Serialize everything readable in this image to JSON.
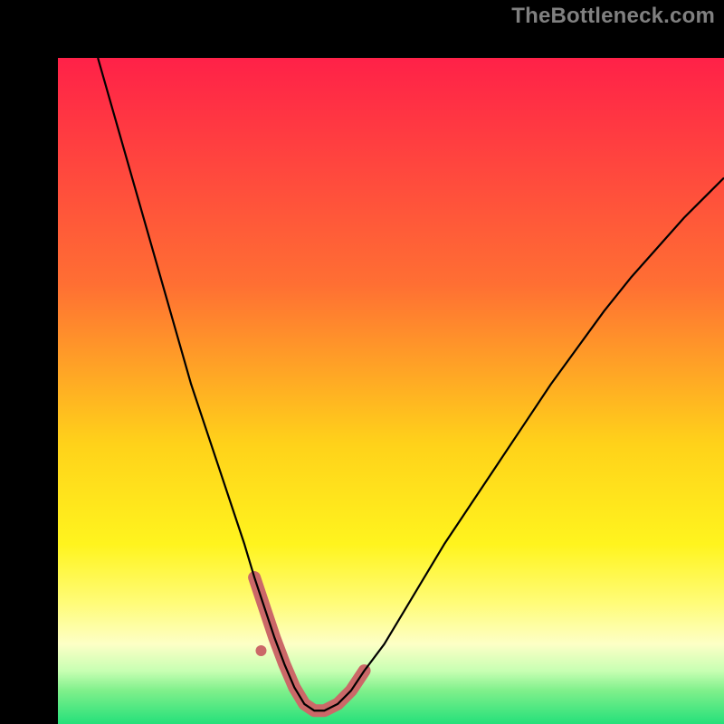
{
  "watermark": "TheBottleneck.com",
  "chart_data": {
    "type": "line",
    "title": "",
    "xlabel": "",
    "ylabel": "",
    "xlim": [
      0,
      100
    ],
    "ylim": [
      0,
      100
    ],
    "background_gradient": {
      "stops": [
        {
          "offset": 0,
          "color": "#ff2148"
        },
        {
          "offset": 34,
          "color": "#ff6f33"
        },
        {
          "offset": 58,
          "color": "#ffd21a"
        },
        {
          "offset": 73,
          "color": "#fff41e"
        },
        {
          "offset": 82,
          "color": "#fffc7a"
        },
        {
          "offset": 88,
          "color": "#fdffc6"
        },
        {
          "offset": 92,
          "color": "#c8ffb3"
        },
        {
          "offset": 95,
          "color": "#7ff08b"
        },
        {
          "offset": 100,
          "color": "#25e07a"
        }
      ]
    },
    "series": [
      {
        "name": "bottleneck-curve",
        "color": "#000000",
        "width": 2.2,
        "x": [
          6,
          8,
          10,
          12,
          14,
          16,
          18,
          20,
          22,
          24,
          26,
          28,
          29.5,
          31,
          32.5,
          34,
          35.5,
          37,
          38.5,
          40,
          42,
          44,
          46,
          49,
          52,
          55,
          58,
          62,
          66,
          70,
          74,
          78,
          82,
          86,
          90,
          94,
          98,
          100
        ],
        "y": [
          100,
          93,
          86,
          79,
          72,
          65,
          58,
          51,
          45,
          39,
          33,
          27,
          22,
          17.5,
          13,
          9,
          5.5,
          3,
          2,
          2,
          3,
          5,
          8,
          12,
          17,
          22,
          27,
          33,
          39,
          45,
          51,
          56.5,
          62,
          67,
          71.5,
          76,
          80,
          82
        ]
      },
      {
        "name": "trough-highlight",
        "color": "#cb6868",
        "width": 14,
        "linecap": "round",
        "x": [
          29.5,
          31,
          32.5,
          34,
          35.5,
          37,
          38.5,
          40,
          42,
          44,
          46
        ],
        "y": [
          22,
          17.5,
          13,
          9,
          5.5,
          3,
          2,
          2,
          3,
          5,
          8
        ]
      }
    ],
    "markers": [
      {
        "name": "trough-dot",
        "x": 30.5,
        "y": 11,
        "r": 6,
        "color": "#cb6868"
      }
    ]
  }
}
